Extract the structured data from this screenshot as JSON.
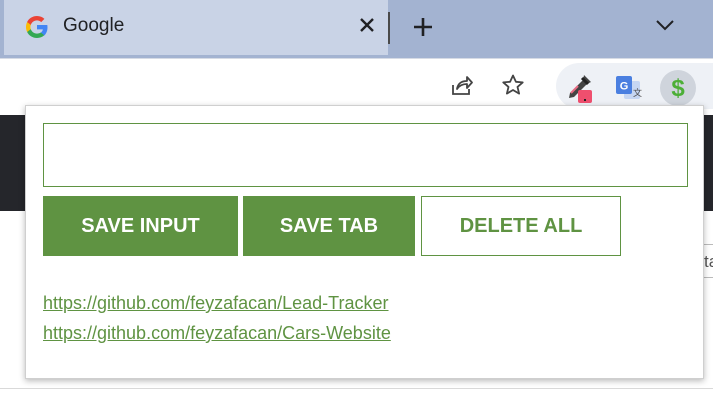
{
  "browser": {
    "tab": {
      "title": "Google",
      "favicon": "google-g-icon"
    },
    "toolbar_icons": [
      "share-icon",
      "bookmark-star-icon"
    ],
    "extensions": [
      "eyedropper-icon",
      "google-translate-icon",
      "dollar-icon"
    ]
  },
  "popup": {
    "input": {
      "value": "",
      "placeholder": ""
    },
    "buttons": {
      "save_input": "SAVE INPUT",
      "save_tab": "SAVE TAB",
      "delete_all": "DELETE ALL"
    },
    "leads": [
      "https://github.com/feyzafacan/Lead-Tracker",
      "https://github.com/feyzafacan/Cars-Website"
    ]
  },
  "page": {
    "edge_text": "ta"
  },
  "colors": {
    "accent": "#5f9342",
    "tabstrip": "#a3b3d1",
    "tab": "#c9d3e6",
    "page_dark": "#25262b"
  }
}
